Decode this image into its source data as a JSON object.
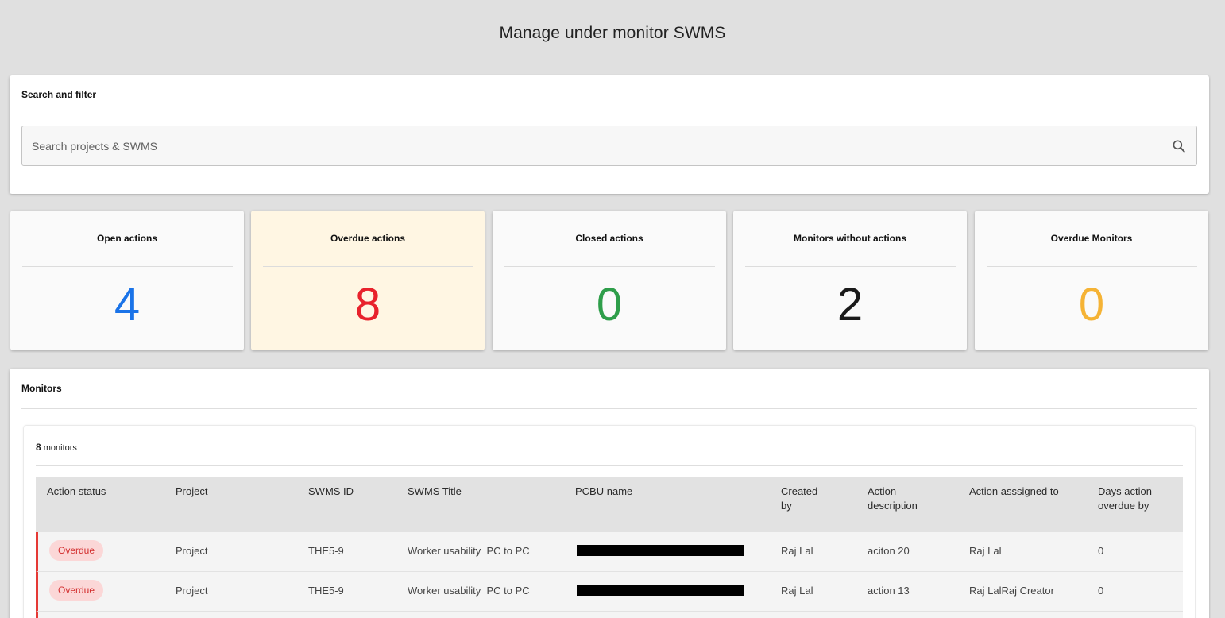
{
  "page": {
    "title": "Manage under monitor SWMS"
  },
  "search": {
    "title": "Search and filter",
    "placeholder": "Search projects & SWMS",
    "icon": "search-icon"
  },
  "stats": [
    {
      "label": "Open actions",
      "value": "4",
      "color": "#1a73e8",
      "highlight": false
    },
    {
      "label": "Overdue actions",
      "value": "8",
      "color": "#e8222c",
      "highlight": true
    },
    {
      "label": "Closed actions",
      "value": "0",
      "color": "#2e9e4a",
      "highlight": false
    },
    {
      "label": "Monitors without actions",
      "value": "2",
      "color": "#1a1a1a",
      "highlight": false
    },
    {
      "label": "Overdue Monitors",
      "value": "0",
      "color": "#f5b335",
      "highlight": false
    }
  ],
  "colors": {
    "highlight_bg": "#fff6e3",
    "overdue_border": "#e53935",
    "badge_bg": "#fbd7d7",
    "badge_text": "#d32f2f"
  },
  "monitors": {
    "title": "Monitors",
    "count": "8",
    "count_label": "monitors",
    "columns": [
      "Action status",
      "Project",
      "SWMS ID",
      "SWMS Title",
      "PCBU name",
      "Created by",
      "Action description",
      "Action asssigned to",
      "Days action overdue by"
    ],
    "rows": [
      {
        "status": "Overdue",
        "project": "Project",
        "swms_id": "THE5-9",
        "swms_title": "Worker usability  PC to PC",
        "created_by": "Raj Lal",
        "action_description": "aciton 20",
        "assigned_to": "Raj Lal",
        "days_overdue": "0"
      },
      {
        "status": "Overdue",
        "project": "Project",
        "swms_id": "THE5-9",
        "swms_title": "Worker usability  PC to PC",
        "created_by": "Raj Lal",
        "action_description": "action 13",
        "assigned_to": "Raj LalRaj Creator",
        "days_overdue": "0"
      }
    ]
  }
}
